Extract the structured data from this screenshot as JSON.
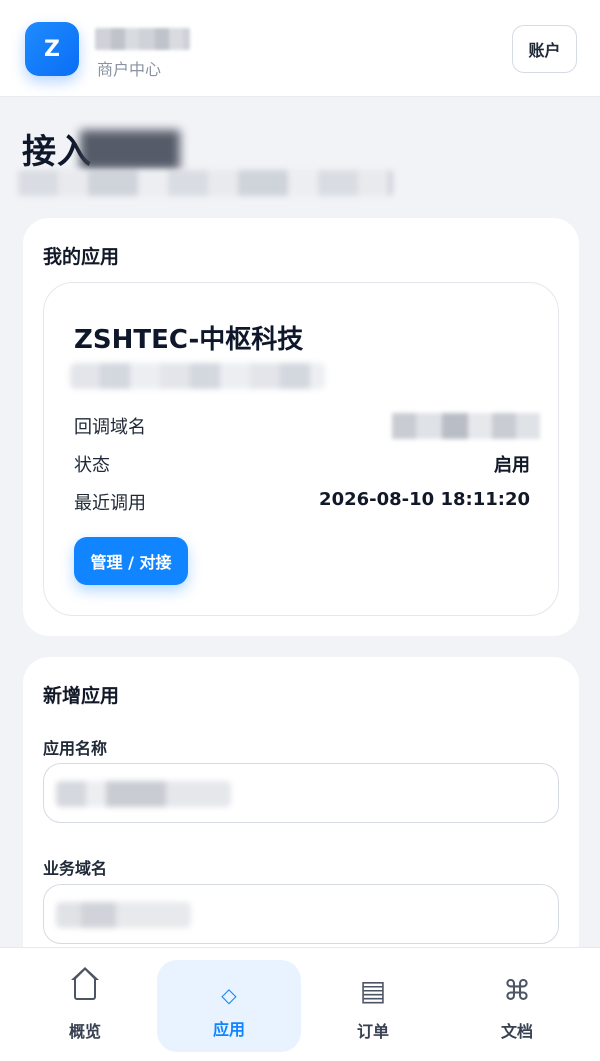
{
  "header": {
    "logo_letter": "Z",
    "brand_sub": "商户中心",
    "account_label": "账户"
  },
  "page": {
    "title": "接入"
  },
  "my_apps": {
    "title": "我的应用",
    "app": {
      "name": "ZSHTEC-中枢科技",
      "domain_label": "回调域名",
      "status_label": "状态",
      "status_value": "启用",
      "last_call_label": "最近调用",
      "last_call_value": "2026-08-10 18:11:20",
      "manage_label": "管理 / 对接"
    }
  },
  "new_app": {
    "title": "新增应用",
    "name_label": "应用名称",
    "domain_label": "业务域名"
  },
  "nav": {
    "items": [
      {
        "label": "概览",
        "icon": "home-icon"
      },
      {
        "label": "应用",
        "icon": "diamond-icon",
        "glyph": "◇"
      },
      {
        "label": "订单",
        "icon": "list-icon",
        "glyph": "▤"
      },
      {
        "label": "文档",
        "icon": "command-icon",
        "glyph": "⌘"
      }
    ],
    "active_index": 1
  },
  "colors": {
    "accent": "#1185ff",
    "background": "#f1f3f7",
    "card": "#ffffff"
  }
}
